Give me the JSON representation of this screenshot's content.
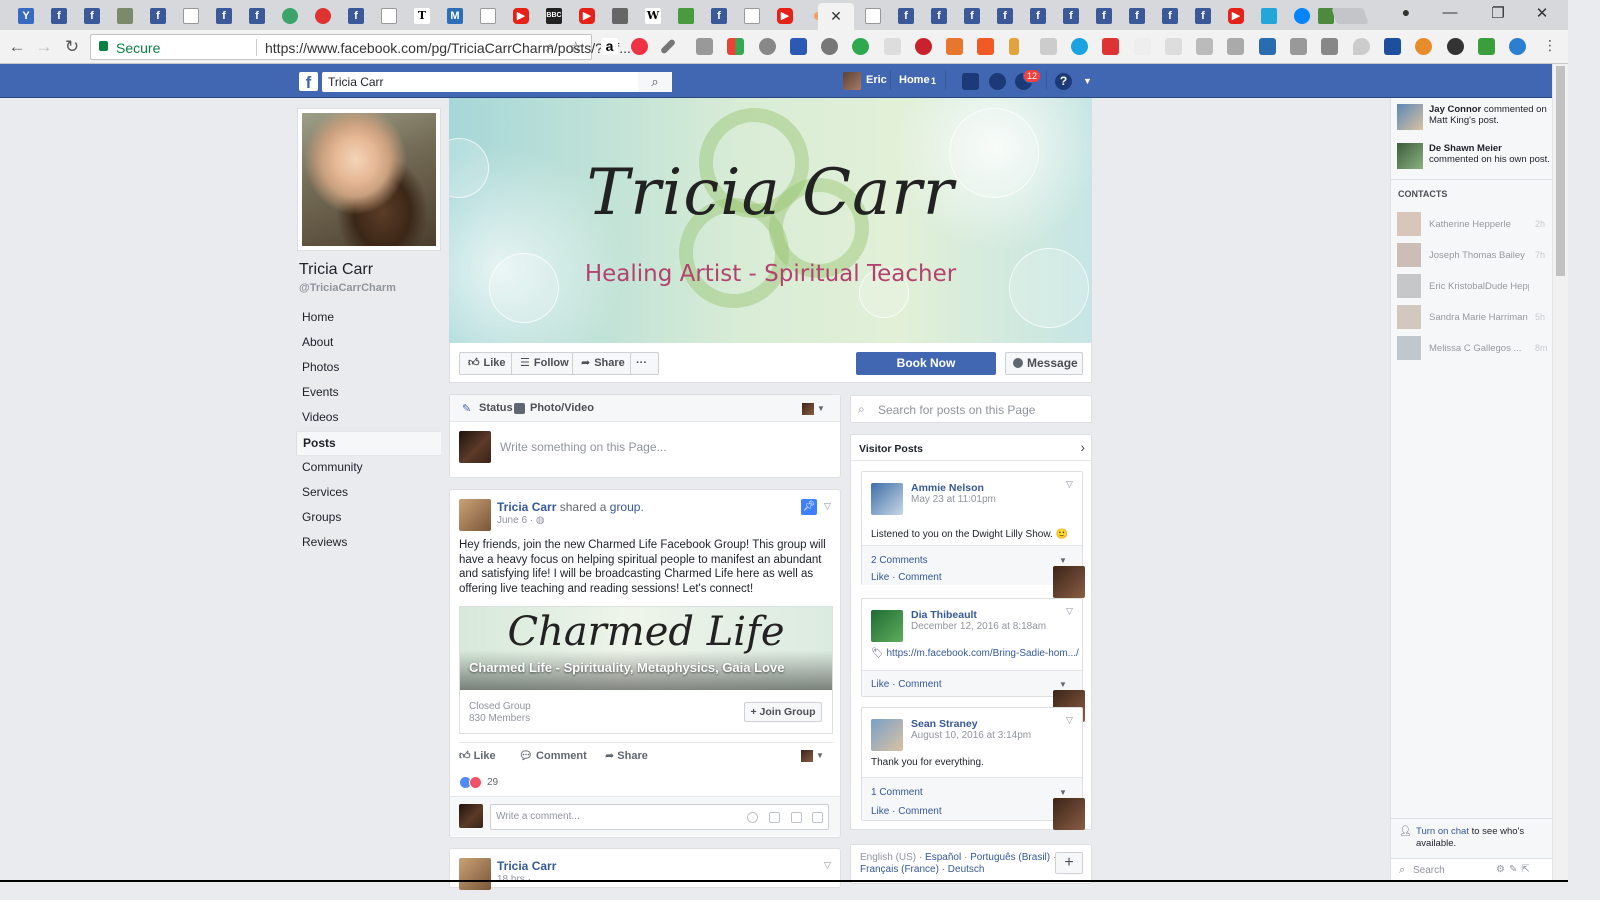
{
  "browser": {
    "secure_label": "Secure",
    "url": "https://www.facebook.com/pg/TriciaCarrCharm/posts/?ref...",
    "window_controls": {
      "minimize": "—",
      "restore": "❐",
      "close": "✕"
    }
  },
  "fb_header": {
    "search_value": "Tricia Carr",
    "user_name": "Eric",
    "home_label": "Home",
    "home_count": "1",
    "notification_count": "12",
    "help_glyph": "?"
  },
  "page": {
    "name": "Tricia Carr",
    "handle": "@TriciaCarrCharm",
    "nav": [
      "Home",
      "About",
      "Photos",
      "Events",
      "Videos",
      "Posts",
      "Community",
      "Services",
      "Groups",
      "Reviews"
    ],
    "active_nav": "Posts"
  },
  "cover": {
    "title": "Tricia Carr",
    "subtitle": "Healing Artist - Spiritual Teacher"
  },
  "actions": {
    "like": "Like",
    "follow": "Follow",
    "share": "Share",
    "more": "···",
    "book_now": "Book Now",
    "message": "Message"
  },
  "composer": {
    "status_tab": "Status",
    "photo_tab": "Photo/Video",
    "placeholder": "Write something on this Page..."
  },
  "post1": {
    "author": "Tricia Carr",
    "action_text": "shared a",
    "action_link": "group",
    "date": "June 6 ·",
    "body": "Hey friends, join the new Charmed Life Facebook Group! This group will have a heavy focus on helping spiritual people to manifest an abundant and satisfying life! I will be broadcasting Charmed Life here as well as offering live teaching and reading sessions! Let's connect!",
    "attachment": {
      "script": "Charmed Life",
      "title": "Charmed Life - Spirituality, Metaphysics, Gaia Love",
      "type": "Closed Group",
      "members": "830 Members",
      "join_label": "+ Join Group"
    },
    "like": "Like",
    "comment": "Comment",
    "share": "Share",
    "reaction_count": "29",
    "comment_placeholder": "Write a comment..."
  },
  "post2": {
    "author": "Tricia Carr",
    "date": "18 hrs ·"
  },
  "right_col": {
    "search_placeholder": "Search for posts on this Page",
    "visitor_posts_title": "Visitor Posts",
    "visitor_posts": [
      {
        "name": "Ammie Nelson",
        "date": "May 23 at 11:01pm",
        "text": "Listened to you on the Dwight Lilly Show. 🙂",
        "comments": "2 Comments",
        "like": "Like",
        "comment": "Comment"
      },
      {
        "name": "Dia Thibeault",
        "date": "December 12, 2016 at 8:18am",
        "text": "https://m.facebook.com/Bring-Sadie-hom.../",
        "like": "Like",
        "comment": "Comment"
      },
      {
        "name": "Sean Straney",
        "date": "August 10, 2016 at 3:14pm",
        "text": "Thank you for everything.",
        "comments": "1 Comment",
        "like": "Like",
        "comment": "Comment"
      }
    ],
    "languages_line1": [
      "English (US)",
      "Español",
      "Português (Brasil)"
    ],
    "languages_line2": [
      "Français (France)",
      "Deutsch"
    ]
  },
  "sidebar": {
    "ticker": [
      {
        "name": "Jay Connor",
        "text": "commented on Matt King's post."
      },
      {
        "name": "De Shawn Meier",
        "text": "commented on his own post."
      }
    ],
    "contacts_title": "CONTACTS",
    "contacts": [
      {
        "name": "Katherine Hepperle",
        "time": "2h"
      },
      {
        "name": "Joseph Thomas Bailey",
        "time": "7h"
      },
      {
        "name": "Eric KristobalDude Hepperle",
        "time": ""
      },
      {
        "name": "Sandra Marie Harriman",
        "time": "5h"
      },
      {
        "name": "Melissa C Gallegos ...",
        "time": "8m"
      }
    ],
    "chat_link": "Turn on chat",
    "chat_rest": " to see who's available.",
    "search_placeholder": "Search"
  },
  "colors": {
    "fb_blue": "#4267b2",
    "link_blue": "#365899",
    "page_bg": "#e9ebee",
    "cover_subtitle": "#b2436f"
  }
}
